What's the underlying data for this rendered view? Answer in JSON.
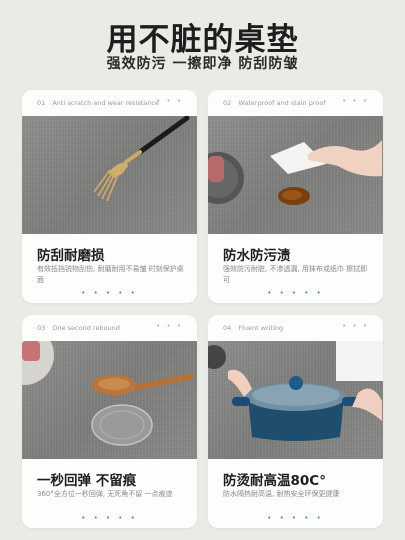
{
  "header": {
    "title": "用不脏的桌垫",
    "subtitle": "强效防污 一擦即净 防刮防皱"
  },
  "cards": [
    {
      "number": "01",
      "caption": "Anti scratch and wear resistance",
      "dots": "• • •",
      "title": "防刮耐磨损",
      "desc": "有效抵挡锐物刮伤, 耐磨耐用不易皱 时刻保护桌面",
      "footer_dots": "• • • • •"
    },
    {
      "number": "02",
      "caption": "Waterproof and stain proof",
      "dots": "• • •",
      "title": "防水防污渍",
      "desc": "强效防污耐脏, 不渗透漏, 用抹布或纸巾 擦拭即可",
      "footer_dots": "• • • • •"
    },
    {
      "number": "03",
      "caption": "One second rebound",
      "dots": "• • •",
      "title": "一秒回弹 不留痕",
      "desc": "360°全方位一秒回弹, 无死角不留 一点痕迹",
      "footer_dots": "• • • • •"
    },
    {
      "number": "04",
      "caption": "Fluent writing",
      "dots": "• • •",
      "title": "防烫耐高温80C°",
      "desc": "防水隔热耐高温, 耐热安全环保更健康",
      "footer_dots": "• • • • •"
    }
  ],
  "colors": {
    "background": "#e9ebe6",
    "card": "#fdfdfc",
    "accent_green": "#3f9a63",
    "mat_gray": "#868684"
  }
}
